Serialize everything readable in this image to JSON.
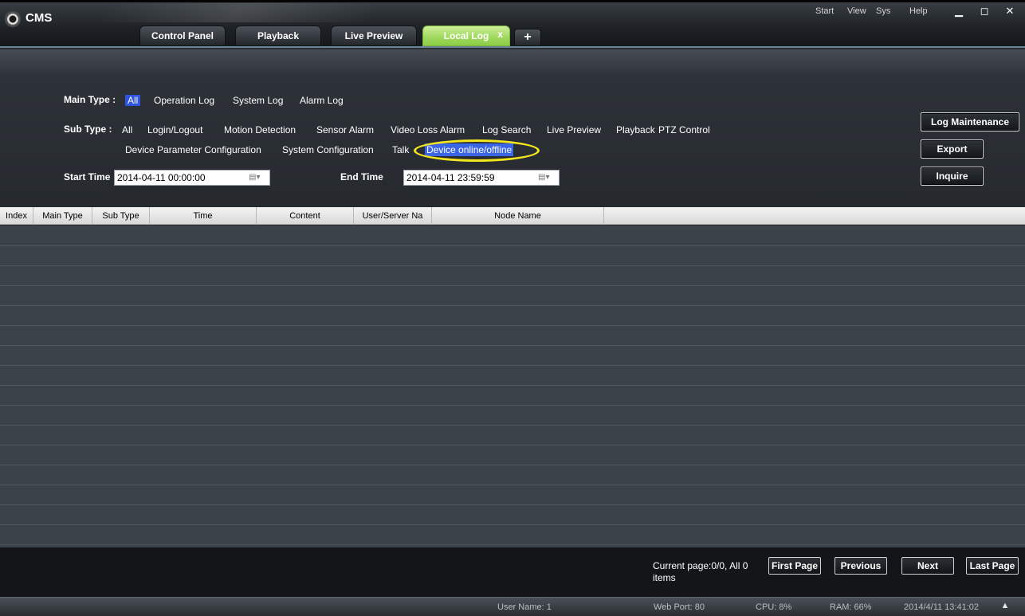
{
  "app": {
    "title": "CMS"
  },
  "menu": {
    "start": "Start",
    "view": "View",
    "sys": "Sys",
    "help": "Help"
  },
  "window_controls": {
    "minimize": "▁",
    "maximize": "◻",
    "close": "✕"
  },
  "tabs": [
    {
      "label": "Control Panel",
      "active": false
    },
    {
      "label": "Playback",
      "active": false
    },
    {
      "label": "Live Preview",
      "active": false
    },
    {
      "label": "Local Log",
      "active": true,
      "close": "x"
    }
  ],
  "tab_add": "+",
  "filters": {
    "main_type_label": "Main Type :",
    "main_types": [
      "All",
      "Operation Log",
      "System Log",
      "Alarm Log"
    ],
    "main_selected": "All",
    "sub_type_label": "Sub Type :",
    "sub_types_row1": [
      "All",
      "Login/Logout",
      "Motion Detection",
      "Sensor Alarm",
      "Video Loss Alarm",
      "Log Search",
      "Live Preview",
      "Playback",
      "PTZ Control"
    ],
    "sub_types_row2": [
      "Device Parameter Configuration",
      "System Configuration",
      "Talk",
      "Device online/offline"
    ],
    "sub_selected": "Device online/offline",
    "start_time_label": "Start Time",
    "start_time_value": "2014-04-11 00:00:00",
    "end_time_label": "End Time",
    "end_time_value": "2014-04-11 23:59:59",
    "calendar_glyph": "▤▾"
  },
  "actions": {
    "log_maintenance": "Log Maintenance",
    "export": "Export",
    "inquire": "Inquire"
  },
  "table": {
    "columns": [
      "Index",
      "Main Type",
      "Sub Type",
      "Time",
      "Content",
      "User/Server Na",
      "Node Name"
    ],
    "rows": []
  },
  "pager": {
    "info": "Current page:0/0, All 0 items",
    "first": "First Page",
    "previous": "Previous",
    "next": "Next",
    "last": "Last Page"
  },
  "status": {
    "user": "User Name: 1",
    "port": "Web Port: 80",
    "cpu": "CPU: 8%",
    "ram": "RAM: 66%",
    "datetime": "2014/4/11 13:41:02",
    "collapse": "▲"
  },
  "colors": {
    "accent_tab": "#9fd85d",
    "selection": "#2f54e0",
    "highlight_ring": "#f3e61e"
  }
}
